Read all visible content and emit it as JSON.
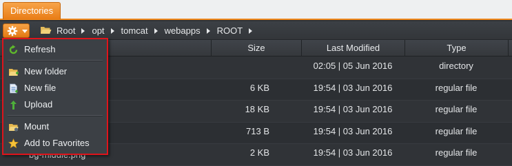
{
  "tab": {
    "label": "Directories"
  },
  "breadcrumb": [
    "Root",
    "opt",
    "tomcat",
    "webapps",
    "ROOT"
  ],
  "columns": {
    "size": "Size",
    "modified": "Last Modified",
    "type": "Type"
  },
  "rows": [
    {
      "name": "",
      "size": "",
      "modified": "02:05 | 05 Jun 2016",
      "type": "directory"
    },
    {
      "name": "",
      "size": "6 KB",
      "modified": "19:54 | 03 Jun 2016",
      "type": "regular file"
    },
    {
      "name": "",
      "size": "18 KB",
      "modified": "19:54 | 03 Jun 2016",
      "type": "regular file"
    },
    {
      "name": "",
      "size": "713 B",
      "modified": "19:54 | 03 Jun 2016",
      "type": "regular file"
    },
    {
      "name": "bg-middle.png",
      "size": "2 KB",
      "modified": "19:54 | 03 Jun 2016",
      "type": "regular file"
    }
  ],
  "menu": {
    "items": [
      {
        "label": "Refresh",
        "icon": "refresh-icon"
      },
      {
        "label": "New folder",
        "icon": "new-folder-icon"
      },
      {
        "label": "New file",
        "icon": "new-file-icon"
      },
      {
        "label": "Upload",
        "icon": "upload-icon"
      },
      {
        "label": "Mount",
        "icon": "mount-icon"
      },
      {
        "label": "Add to Favorites",
        "icon": "star-icon"
      }
    ]
  },
  "colors": {
    "accent": "#f0881b",
    "menu_border": "#e0141b",
    "background": "#2f3236"
  }
}
